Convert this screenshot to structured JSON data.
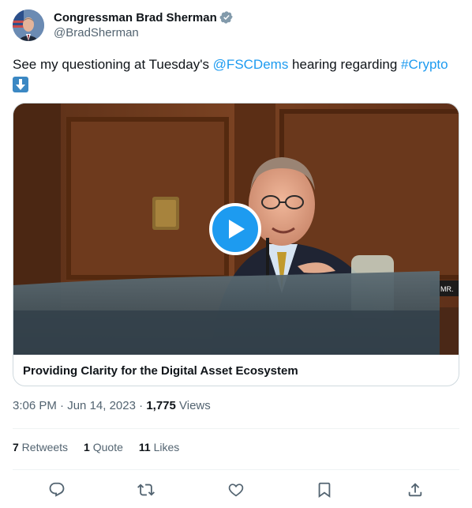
{
  "author": {
    "display_name": "Congressman Brad Sherman",
    "handle": "@BradSherman",
    "verified": true
  },
  "tweet": {
    "text_before": "See my questioning at Tuesday's ",
    "mention": "@FSCDems",
    "text_middle": " hearing regarding ",
    "hashtag": "#Crypto",
    "emoji": "down-arrow-emoji"
  },
  "card": {
    "title": "Providing Clarity for the Digital Asset Ecosystem",
    "nameplate_text": "MR."
  },
  "meta": {
    "time": "3:06 PM",
    "separator": " · ",
    "date": "Jun 14, 2023",
    "views_count": "1,775",
    "views_label": " Views"
  },
  "stats": {
    "retweets_count": "7",
    "retweets_label": " Retweets",
    "quotes_count": "1",
    "quotes_label": " Quote",
    "likes_count": "11",
    "likes_label": " Likes"
  },
  "actions": [
    "reply-icon",
    "retweet-icon",
    "like-icon",
    "bookmark-icon",
    "share-icon"
  ],
  "colors": {
    "accent": "#1d9bf0",
    "text": "#0f1419",
    "muted": "#536471",
    "border": "#cfd9de",
    "divider": "#eff3f4"
  }
}
